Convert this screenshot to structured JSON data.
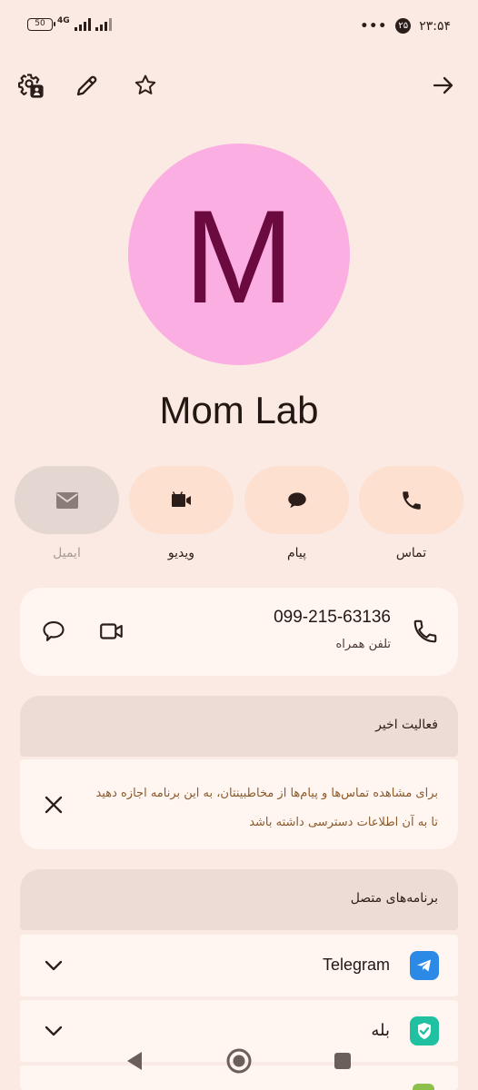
{
  "status_bar": {
    "battery": "50",
    "network": "4G",
    "time": "۲۳:۵۴",
    "notification_count": "۲۵",
    "more": "•••"
  },
  "contact": {
    "initial": "M",
    "name": "Mom Lab",
    "avatar_color": "#fbaee2",
    "initial_color": "#6b0a3f"
  },
  "actions": [
    {
      "label": "تماس",
      "icon": "phone-icon"
    },
    {
      "label": "پیام",
      "icon": "message-icon"
    },
    {
      "label": "ویدیو",
      "icon": "video-icon"
    },
    {
      "label": "ایمیل",
      "icon": "email-icon",
      "disabled": true
    }
  ],
  "phone": {
    "number": "099-215-63136",
    "type": "تلفن همراه"
  },
  "recent_activity": {
    "title": "فعالیت اخیر",
    "permission_text": "برای مشاهده تماس‌ها و پیام‌ها از مخاطبینتان، به این برنامه اجازه دهید تا به آن اطلاعات دسترسی داشته باشد"
  },
  "connected_apps": {
    "title": "برنامه‌های متصل",
    "apps": [
      {
        "name": "Telegram",
        "icon": "telegram-icon"
      },
      {
        "name": "بله",
        "icon": "bale-icon"
      }
    ]
  },
  "colors": {
    "background": "#fbeae3",
    "action_bg": "#fde0cf",
    "telegram": "#2b8ae6",
    "bale": "#1fc1a0"
  }
}
